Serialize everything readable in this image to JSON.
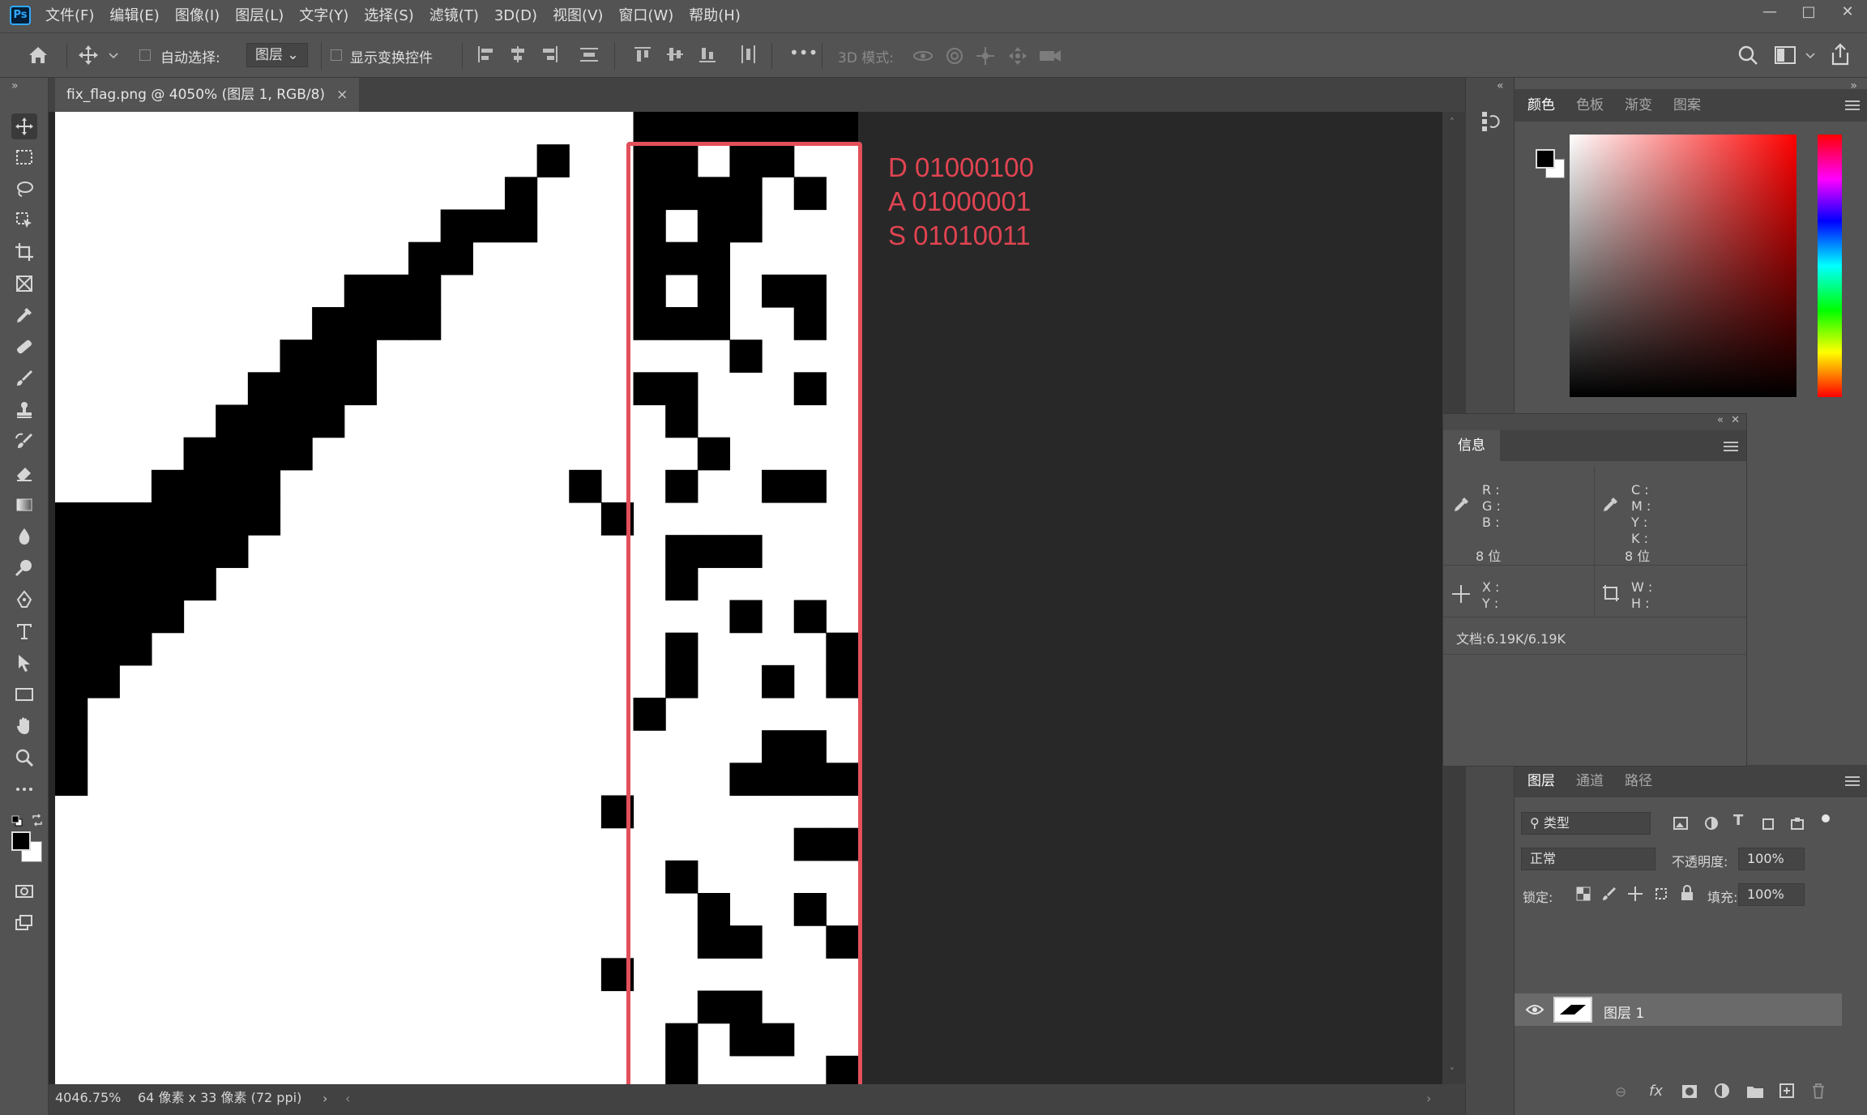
{
  "app": {
    "logo": "Ps"
  },
  "menu": [
    "文件(F)",
    "编辑(E)",
    "图像(I)",
    "图层(L)",
    "文字(Y)",
    "选择(S)",
    "滤镜(T)",
    "3D(D)",
    "视图(V)",
    "窗口(W)",
    "帮助(H)"
  ],
  "window_controls": {
    "minimize": "—",
    "maximize": "□",
    "close": "✕"
  },
  "options": {
    "auto_select_label": "自动选择:",
    "auto_select_value": "图层",
    "show_transform_label": "显示变换控件",
    "more": "•••",
    "mode_3d_label": "3D 模式:"
  },
  "document_tab": {
    "title": "fix_flag.png @ 4050% (图层 1, RGB/8)",
    "close": "×"
  },
  "annotation_lines": [
    "D 01000100",
    "A 01000001",
    "S 01010011"
  ],
  "pixel_grid": {
    "cols": 25,
    "rows": 30,
    "rows_data": [
      "..................#######",
      "...............#..##.##..",
      "..............#...####.#.",
      "............###...#.##...",
      "...........##.....###....",
      ".........###......#.#.##.",
      "........####......###..#.",
      ".......###...........#...",
      "......####........##...#.",
      ".....####..........#.....",
      "....####............#....",
      "...####.........#..#..##.",
      "#######..........#.......",
      "######.............###...",
      "#####..............#.....",
      "####.................#.#.",
      "###................#....#",
      "##.................#..#.#",
      "#.................#......",
      "#.....................##.",
      "#....................####",
      ".................#.......",
      ".......................##",
      "...................#.....",
      "....................#..#.",
      "....................##..#",
      ".................#.......",
      "....................##...",
      "...................#.##..",
      "...................#....#"
    ]
  },
  "status": {
    "zoom": "4046.75%",
    "doc_size": "64 像素 x 33 像素 (72 ppi)"
  },
  "color_panel": {
    "tabs": [
      "颜色",
      "色板",
      "渐变",
      "图案"
    ],
    "active": "颜色"
  },
  "info_panel": {
    "title": "信息",
    "rgb_labels": [
      "R :",
      "G :",
      "B :"
    ],
    "cmyk_labels": [
      "C :",
      "M :",
      "Y :",
      "K :"
    ],
    "bits_left": "8 位",
    "bits_right": "8 位",
    "xy_labels": [
      "X :",
      "Y :"
    ],
    "wh_labels": [
      "W :",
      "H :"
    ],
    "doc_info": "文档:6.19K/6.19K"
  },
  "layers_panel": {
    "tabs": [
      "图层",
      "通道",
      "路径"
    ],
    "active": "图层",
    "filter_kind": "类型",
    "blend_mode": "正常",
    "opacity_label": "不透明度:",
    "opacity_value": "100%",
    "lock_label": "锁定:",
    "fill_label": "填充:",
    "fill_value": "100%",
    "layers": [
      {
        "name": "图层 1",
        "visible": true
      }
    ]
  },
  "colors": {
    "annotation": "#e04452",
    "highlight_box": "#e2505a",
    "ui_dark": "#535353",
    "canvas_bg": "#282828"
  }
}
